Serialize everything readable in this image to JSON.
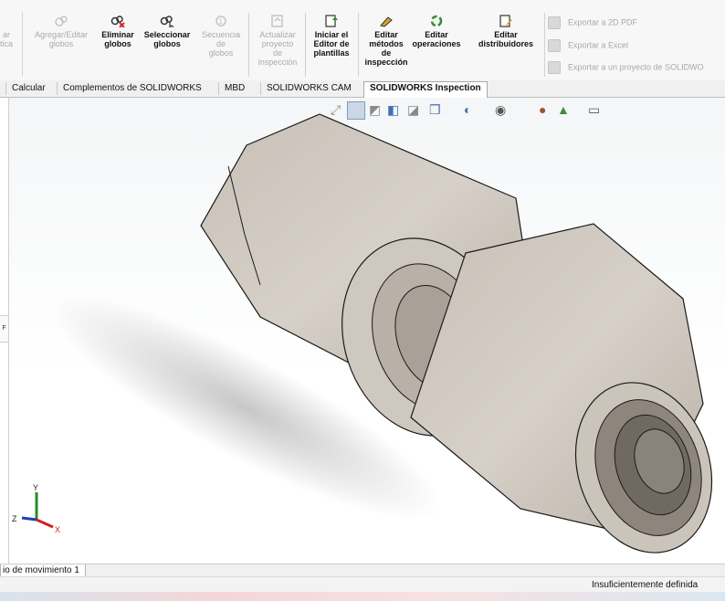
{
  "ribbon": {
    "buttons": [
      {
        "label": "ar\ntica",
        "enabled": false
      },
      {
        "label": "Agregar/Editar\nglobos",
        "enabled": false
      },
      {
        "label": "Eliminar\nglobos",
        "enabled": true
      },
      {
        "label": "Seleccionar\nglobos",
        "enabled": true
      },
      {
        "label": "Secuencia\nde\nglobos",
        "enabled": false
      },
      {
        "label": "Actualizar\nproyecto\nde\ninspección",
        "enabled": false
      },
      {
        "label": "Iniciar el\nEditor de\nplantillas",
        "enabled": true
      },
      {
        "label": "Editar\nmétodos\nde\ninspección",
        "enabled": true
      },
      {
        "label": "Editar\noperaciones",
        "enabled": true
      },
      {
        "label": "Editar\ndistribuidores",
        "enabled": true
      }
    ],
    "exports": [
      "Exportar a 2D PDF",
      "Exportar a Excel",
      "Exportar a un proyecto de SOLIDWO"
    ]
  },
  "tabs": [
    "Calcular",
    "Complementos de SOLIDWORKS",
    "MBD",
    "SOLIDWORKS CAM",
    "SOLIDWORKS Inspection"
  ],
  "active_tab": "SOLIDWORKS Inspection",
  "left_strip_glyph": "F",
  "triad": {
    "x": "X",
    "y": "Y",
    "z": "Z"
  },
  "motion_tab": "io de movimiento 1",
  "status": "Insuficientemente definida",
  "colors": {
    "ribbon": "#f7f7f7",
    "part": "#cdc5bc",
    "active_tab_bg": "#ffffff",
    "triad_x": "#d32020",
    "triad_y": "#2a8a2a",
    "triad_z": "#1f3fb0"
  }
}
